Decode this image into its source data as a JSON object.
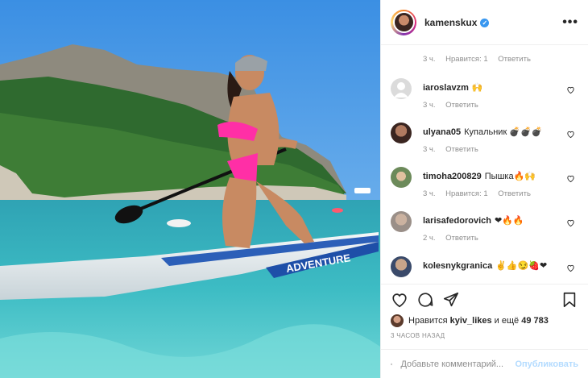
{
  "post": {
    "username": "kamenskux",
    "verified": true,
    "more_icon": "more-horizontal-icon"
  },
  "comments": [
    {
      "partial": true,
      "text": "",
      "time": "3 ч.",
      "likes": "Нравится: 1",
      "reply": "Ответить"
    },
    {
      "user": "iaroslavzm",
      "text": "🙌",
      "time": "3 ч.",
      "reply": "Ответить",
      "avatar_color": "#dbdbdb"
    },
    {
      "user": "ulyana05",
      "text": "Купальник 💣💣💣",
      "time": "3 ч.",
      "reply": "Ответить",
      "avatar_color": "#5a3a30"
    },
    {
      "user": "timoha200829",
      "text": "Пышка🔥🙌",
      "time": "3 ч.",
      "likes": "Нравится: 1",
      "reply": "Ответить",
      "avatar_color": "#6c8a5a"
    },
    {
      "user": "larisafedorovich",
      "text": "❤🔥🔥",
      "time": "2 ч.",
      "reply": "Ответить",
      "avatar_color": "#9a8f88"
    },
    {
      "user": "kolesnykgranica",
      "text": "✌👍😏🍓❤",
      "avatar_color": "#3a4a6a"
    }
  ],
  "likes": {
    "prefix": "Нравится",
    "liker": "kyiv_likes",
    "middle": "и ещё",
    "count": "49 783"
  },
  "time_ago": "3 ЧАСОВ НАЗАД",
  "add_comment": {
    "placeholder": "Добавьте комментарий...",
    "publish": "Опубликовать"
  },
  "colors": {
    "accent": "#3897f0",
    "publish_disabled": "#b3dbff",
    "muted": "#8e8e8e"
  }
}
